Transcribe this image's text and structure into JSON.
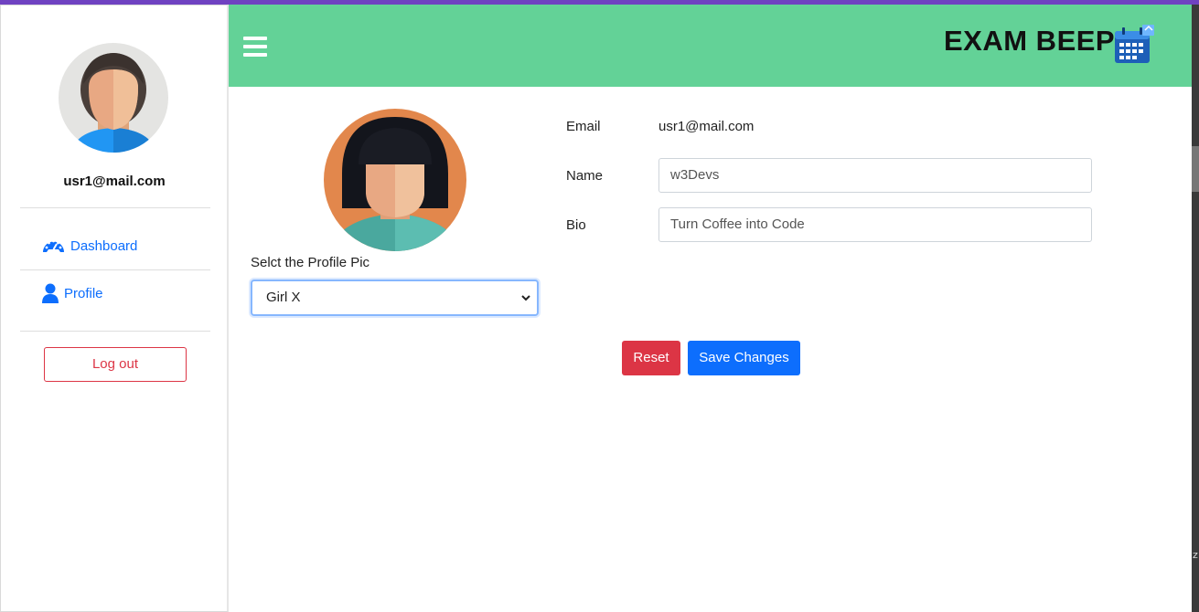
{
  "sidebar": {
    "user_email": "usr1@mail.com",
    "nav": {
      "dashboard": "Dashboard",
      "profile": "Profile"
    },
    "logout_label": "Log out"
  },
  "header": {
    "brand": "EXAM BEEP"
  },
  "profile_pic": {
    "label": "Selct the Profile Pic",
    "selected": "Girl X"
  },
  "form": {
    "email_label": "Email",
    "email_value": "usr1@mail.com",
    "name_label": "Name",
    "name_value": "w3Devs",
    "bio_label": "Bio",
    "bio_value": "Turn Coffee into Code"
  },
  "actions": {
    "reset": "Reset",
    "save": "Save Changes"
  },
  "colors": {
    "header_bg": "#63d297",
    "primary": "#0d6efd",
    "danger": "#dc3545"
  },
  "icons": [
    "menu-icon",
    "calendar-icon",
    "dashboard-icon",
    "user-icon",
    "chevron-down-icon"
  ]
}
